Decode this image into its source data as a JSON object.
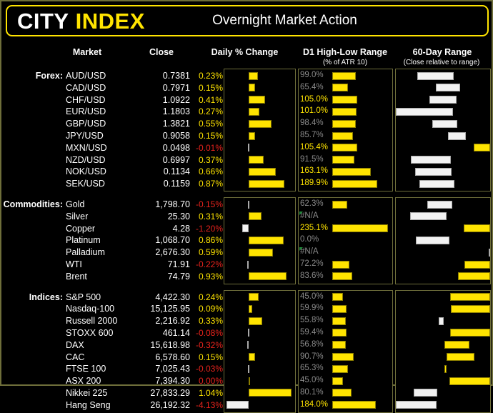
{
  "header": {
    "logo_primary": "CITY",
    "logo_secondary": "INDEX",
    "title": "Overnight Market Action"
  },
  "columns": {
    "market": "Market",
    "close": "Close",
    "daily_change": "Daily % Change",
    "d1_range": "D1 High-Low Range",
    "d1_range_sub": "(% of ATR 10)",
    "sixty_day_range": "60-Day Range",
    "sixty_day_range_sub": "(Close relative to range)"
  },
  "colors": {
    "accent": "#ffe400",
    "negative": "#e8231c",
    "white_bar": "#f2f2f2",
    "panel_border": "#6e6e3a",
    "background": "#000000",
    "na_marker": "#1f8b3a"
  },
  "sections": [
    {
      "label": "Forex:",
      "rows": [
        {
          "market": "AUD/USD",
          "close": "0.7381",
          "change": "0.23%",
          "change_val": 0.23,
          "d1": "99.0%",
          "d1_val": 99.0,
          "range_pos": 0.37,
          "range_width": 0.63,
          "range_color": "white"
        },
        {
          "market": "CAD/USD",
          "close": "0.7971",
          "change": "0.15%",
          "change_val": 0.15,
          "d1": "65.4%",
          "d1_val": 65.4,
          "range_pos": 0.57,
          "range_width": 0.42,
          "range_color": "white"
        },
        {
          "market": "CHF/USD",
          "close": "1.0922",
          "change": "0.41%",
          "change_val": 0.41,
          "d1": "105.0%",
          "d1_val": 105.0,
          "range_pos": 0.5,
          "range_width": 0.47,
          "range_color": "white"
        },
        {
          "market": "EUR/USD",
          "close": "1.1803",
          "change": "0.27%",
          "change_val": 0.27,
          "d1": "101.0%",
          "d1_val": 101.0,
          "range_pos": 0.0,
          "range_width": 0.98,
          "range_color": "white"
        },
        {
          "market": "GBP/USD",
          "close": "1.3821",
          "change": "0.55%",
          "change_val": 0.55,
          "d1": "98.4%",
          "d1_val": 98.4,
          "range_pos": 0.53,
          "range_width": 0.43,
          "range_color": "white"
        },
        {
          "market": "JPY/USD",
          "close": "0.9058",
          "change": "0.15%",
          "change_val": 0.15,
          "d1": "85.7%",
          "d1_val": 85.7,
          "range_pos": 0.68,
          "range_width": 0.31,
          "range_color": "white"
        },
        {
          "market": "MXN/USD",
          "close": "0.0498",
          "change": "-0.01%",
          "change_val": -0.01,
          "d1": "105.4%",
          "d1_val": 105.4,
          "range_pos": 1.0,
          "range_width": 0.28,
          "range_color": "yellow"
        },
        {
          "market": "NZD/USD",
          "close": "0.6997",
          "change": "0.37%",
          "change_val": 0.37,
          "d1": "91.5%",
          "d1_val": 91.5,
          "range_pos": 0.28,
          "range_width": 0.68,
          "range_color": "white"
        },
        {
          "market": "NOK/USD",
          "close": "0.1134",
          "change": "0.66%",
          "change_val": 0.66,
          "d1": "163.1%",
          "d1_val": 163.1,
          "range_pos": 0.33,
          "range_width": 0.62,
          "range_color": "white"
        },
        {
          "market": "SEK/USD",
          "close": "0.1159",
          "change": "0.87%",
          "change_val": 0.87,
          "d1": "189.9%",
          "d1_val": 189.9,
          "range_pos": 0.4,
          "range_width": 0.6,
          "range_color": "white"
        }
      ]
    },
    {
      "label": "Commodities:",
      "rows": [
        {
          "market": "Gold",
          "close": "1,798.70",
          "change": "-0.15%",
          "change_val": -0.15,
          "d1": "62.3%",
          "d1_val": 62.3,
          "range_pos": 0.45,
          "range_width": 0.43,
          "range_color": "white"
        },
        {
          "market": "Silver",
          "close": "25.30",
          "change": "0.31%",
          "change_val": 0.31,
          "d1": "#N/A",
          "d1_val": null,
          "range_pos": 0.25,
          "range_width": 0.62,
          "range_color": "white"
        },
        {
          "market": "Copper",
          "close": "4.28",
          "change": "-1.20%",
          "change_val": -1.2,
          "d1": "235.1%",
          "d1_val": 235.1,
          "range_pos": 1.0,
          "range_width": 0.45,
          "range_color": "yellow"
        },
        {
          "market": "Platinum",
          "close": "1,068.70",
          "change": "0.86%",
          "change_val": 0.86,
          "d1": "0.0%",
          "d1_val": 0.0,
          "range_pos": 0.33,
          "range_width": 0.57,
          "range_color": "white"
        },
        {
          "market": "Palladium",
          "close": "2,676.30",
          "change": "0.59%",
          "change_val": 0.59,
          "d1": "#N/A",
          "d1_val": null,
          "range_pos": 1.0,
          "range_width": 0.03,
          "range_color": "white"
        },
        {
          "market": "WTI",
          "close": "71.91",
          "change": "-0.22%",
          "change_val": -0.22,
          "d1": "72.2%",
          "d1_val": 72.2,
          "range_pos": 1.0,
          "range_width": 0.44,
          "range_color": "yellow"
        },
        {
          "market": "Brent",
          "close": "74.79",
          "change": "0.93%",
          "change_val": 0.93,
          "d1": "83.6%",
          "d1_val": 83.6,
          "range_pos": 1.0,
          "range_width": 0.55,
          "range_color": "yellow"
        }
      ]
    },
    {
      "label": "Indices:",
      "rows": [
        {
          "market": "S&P 500",
          "close": "4,422.30",
          "change": "0.24%",
          "change_val": 0.24,
          "d1": "45.0%",
          "d1_val": 45.0,
          "range_pos": 1.0,
          "range_width": 0.68,
          "range_color": "yellow"
        },
        {
          "market": "Nasdaq-100",
          "close": "15,125.95",
          "change": "0.09%",
          "change_val": 0.09,
          "d1": "59.9%",
          "d1_val": 59.9,
          "range_pos": 1.0,
          "range_width": 0.67,
          "range_color": "yellow"
        },
        {
          "market": "Russell 2000",
          "close": "2,216.92",
          "change": "0.33%",
          "change_val": 0.33,
          "d1": "55.8%",
          "d1_val": 55.8,
          "range_pos": 0.48,
          "range_width": 0.08,
          "range_color": "white"
        },
        {
          "market": "STOXX 600",
          "close": "461.14",
          "change": "-0.08%",
          "change_val": -0.08,
          "d1": "59.4%",
          "d1_val": 59.4,
          "range_pos": 1.0,
          "range_width": 0.69,
          "range_color": "yellow"
        },
        {
          "market": "DAX",
          "close": "15,618.98",
          "change": "-0.32%",
          "change_val": -0.32,
          "d1": "56.8%",
          "d1_val": 56.8,
          "range_pos": 0.7,
          "range_width": 0.42,
          "range_color": "yellow"
        },
        {
          "market": "CAC",
          "close": "6,578.60",
          "change": "0.15%",
          "change_val": 0.15,
          "d1": "90.7%",
          "d1_val": 90.7,
          "range_pos": 0.76,
          "range_width": 0.47,
          "range_color": "yellow"
        },
        {
          "market": "FTSE 100",
          "close": "7,025.43",
          "change": "-0.03%",
          "change_val": -0.03,
          "d1": "65.3%",
          "d1_val": 65.3,
          "range_pos": 0.53,
          "range_width": 0.04,
          "range_color": "yellow"
        },
        {
          "market": "ASX 200",
          "close": "7,394.30",
          "change": "0.00%",
          "change_val": 0.0,
          "d1": "45.0%",
          "d1_val": 45.0,
          "range_pos": 1.0,
          "range_width": 0.7,
          "range_color": "yellow"
        },
        {
          "market": "Nikkei 225",
          "close": "27,833.29",
          "change": "1.04%",
          "change_val": 1.04,
          "d1": "80.1%",
          "d1_val": 80.1,
          "range_pos": 0.25,
          "range_width": 0.4,
          "range_color": "white"
        },
        {
          "market": "Hang Seng",
          "close": "26,192.32",
          "change": "-4.13%",
          "change_val": -4.13,
          "d1": "184.0%",
          "d1_val": 184.0,
          "range_pos": 0.0,
          "range_width": 0.7,
          "range_color": "white"
        }
      ]
    }
  ],
  "chart_data": {
    "type": "bar",
    "title": "Overnight Market Action",
    "panels": [
      {
        "name": "Daily % Change",
        "type": "bar",
        "orientation": "horizontal-diverging",
        "zero_line": true,
        "xlim": [
          -4.5,
          1.5
        ],
        "categories": [
          "AUD/USD",
          "CAD/USD",
          "CHF/USD",
          "EUR/USD",
          "GBP/USD",
          "JPY/USD",
          "MXN/USD",
          "NZD/USD",
          "NOK/USD",
          "SEK/USD",
          "Gold",
          "Silver",
          "Copper",
          "Platinum",
          "Palladium",
          "WTI",
          "Brent",
          "S&P 500",
          "Nasdaq-100",
          "Russell 2000",
          "STOXX 600",
          "DAX",
          "CAC",
          "FTSE 100",
          "ASX 200",
          "Nikkei 225",
          "Hang Seng"
        ],
        "values": [
          0.23,
          0.15,
          0.41,
          0.27,
          0.55,
          0.15,
          -0.01,
          0.37,
          0.66,
          0.87,
          -0.15,
          0.31,
          -1.2,
          0.86,
          0.59,
          -0.22,
          0.93,
          0.24,
          0.09,
          0.33,
          -0.08,
          -0.32,
          0.15,
          -0.03,
          0.0,
          1.04,
          -4.13
        ],
        "ylabel": "",
        "xlabel": "%"
      },
      {
        "name": "D1 High-Low Range (% of ATR 10)",
        "type": "bar",
        "orientation": "horizontal",
        "xlim": [
          0,
          240
        ],
        "categories": [
          "AUD/USD",
          "CAD/USD",
          "CHF/USD",
          "EUR/USD",
          "GBP/USD",
          "JPY/USD",
          "MXN/USD",
          "NZD/USD",
          "NOK/USD",
          "SEK/USD",
          "Gold",
          "Silver",
          "Copper",
          "Platinum",
          "Palladium",
          "WTI",
          "Brent",
          "S&P 500",
          "Nasdaq-100",
          "Russell 2000",
          "STOXX 600",
          "DAX",
          "CAC",
          "FTSE 100",
          "ASX 200",
          "Nikkei 225",
          "Hang Seng"
        ],
        "values": [
          99.0,
          65.4,
          105.0,
          101.0,
          98.4,
          85.7,
          105.4,
          91.5,
          163.1,
          189.9,
          62.3,
          null,
          235.1,
          0.0,
          null,
          72.2,
          83.6,
          45.0,
          59.9,
          55.8,
          59.4,
          56.8,
          90.7,
          65.3,
          45.0,
          80.1,
          184.0
        ],
        "labels": [
          "99.0%",
          "65.4%",
          "105.0%",
          "101.0%",
          "98.4%",
          "85.7%",
          "105.4%",
          "91.5%",
          "163.1%",
          "189.9%",
          "62.3%",
          "#N/A",
          "235.1%",
          "0.0%",
          "#N/A",
          "72.2%",
          "83.6%",
          "45.0%",
          "59.9%",
          "55.8%",
          "59.4%",
          "56.8%",
          "90.7%",
          "65.3%",
          "45.0%",
          "80.1%",
          "184.0%"
        ]
      },
      {
        "name": "60-Day Range (Close relative to range)",
        "type": "bar",
        "orientation": "horizontal-span",
        "xlim": [
          0,
          1
        ],
        "categories": [
          "AUD/USD",
          "CAD/USD",
          "CHF/USD",
          "EUR/USD",
          "GBP/USD",
          "JPY/USD",
          "MXN/USD",
          "NZD/USD",
          "NOK/USD",
          "SEK/USD",
          "Gold",
          "Silver",
          "Copper",
          "Platinum",
          "Palladium",
          "WTI",
          "Brent",
          "S&P 500",
          "Nasdaq-100",
          "Russell 2000",
          "STOXX 600",
          "DAX",
          "CAC",
          "FTSE 100",
          "ASX 200",
          "Nikkei 225",
          "Hang Seng"
        ]
      }
    ]
  }
}
